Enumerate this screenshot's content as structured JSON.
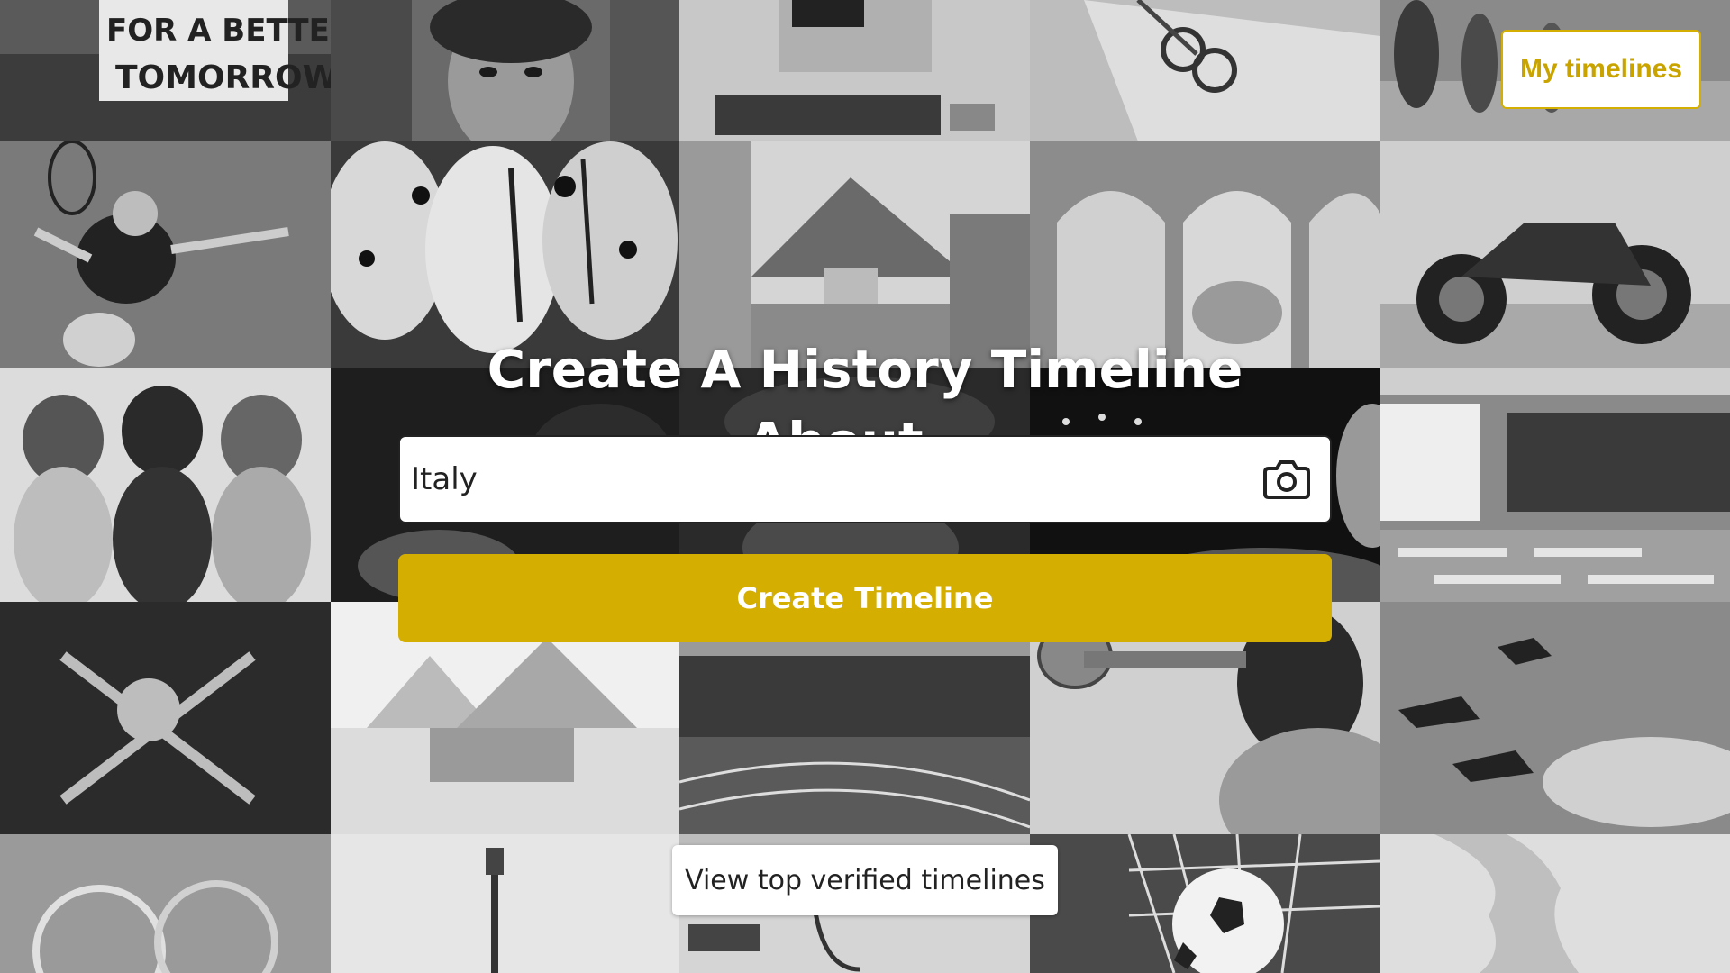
{
  "header": {
    "my_timelines_label": "My timelines"
  },
  "hero": {
    "title": "Create A History Timeline About...",
    "search": {
      "value": "Italy",
      "placeholder": ""
    },
    "camera_icon": "camera-icon",
    "create_button_label": "Create Timeline"
  },
  "footer": {
    "view_top_label": "View top verified timelines"
  },
  "collage": {
    "tiles": [
      {
        "subject": "protest-sign",
        "text_lines": [
          "FOR A BETTER",
          "TOMORROW"
        ]
      },
      {
        "subject": "portrait-painting"
      },
      {
        "subject": "vintage-computer"
      },
      {
        "subject": "scissors-and-papers"
      },
      {
        "subject": "street-crowd"
      },
      {
        "subject": "tennis-player"
      },
      {
        "subject": "paper-lanterns"
      },
      {
        "subject": "volcano-street"
      },
      {
        "subject": "arches-and-dome"
      },
      {
        "subject": "motorcycle"
      },
      {
        "subject": "three-women-singers"
      },
      {
        "subject": "concert-stage"
      },
      {
        "subject": "classroom"
      },
      {
        "subject": "pirate-flag"
      },
      {
        "subject": "pyramids-and-sphinx"
      },
      {
        "subject": "running-track"
      },
      {
        "subject": "trumpet-player"
      },
      {
        "subject": "bomber-planes"
      },
      {
        "subject": "film-reels"
      },
      {
        "subject": "guitar"
      },
      {
        "subject": "stethoscope"
      },
      {
        "subject": "soccer-ball-in-net"
      },
      {
        "subject": "map"
      }
    ],
    "colors": {
      "accent": "#d4ae00",
      "background": "#1a1a1a"
    }
  }
}
